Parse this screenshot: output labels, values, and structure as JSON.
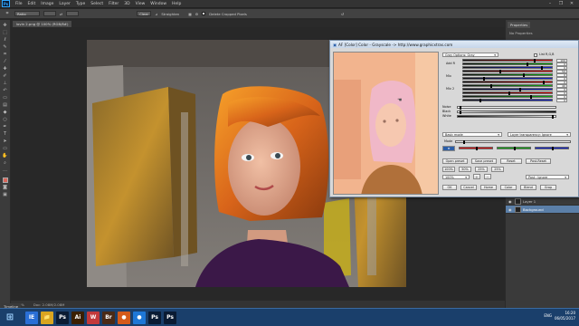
{
  "app": {
    "logo_text": "Ps"
  },
  "menu": {
    "items": [
      "File",
      "Edit",
      "Image",
      "Layer",
      "Type",
      "Select",
      "Filter",
      "3D",
      "View",
      "Window",
      "Help"
    ]
  },
  "window_controls": {
    "minimize": "–",
    "restore": "❐",
    "close": "✕"
  },
  "options_bar": {
    "ratio_value": "Ratio",
    "clear_label": "Clear",
    "straighten_label": "Straighten",
    "delete_cropped_label": "Delete Cropped Pixels"
  },
  "document": {
    "tab_label": "lovin 2.png @ 100% (RGB/8#)"
  },
  "status": {
    "zoom": "100%",
    "doc_info": "Doc: 2.08M/2.08M"
  },
  "panels": {
    "properties_tab": "Properties",
    "properties_text": "No Properties",
    "layers": [
      {
        "name": "Layer 1",
        "active": false
      },
      {
        "name": "Background",
        "active": true
      }
    ],
    "timeline_tab": "Timeline"
  },
  "dialog": {
    "title": "AF [Color] Color - Grayscale  -> http://www.graphicxtras.com",
    "preset": "Gray Options: Gray",
    "list_rgb_label": "List R,G,B",
    "channel_labels": [
      "Add R",
      "Mix",
      "Mix 2"
    ],
    "noise_label": "Noise",
    "black_label": "Black",
    "white_label": "White",
    "slider_values": [
      "100",
      "0",
      "0",
      "50",
      "0",
      "0",
      "0",
      "40",
      "0",
      "0",
      "0",
      "0"
    ],
    "blend_mode": "Basic mode",
    "layer_option": "Layer transparency: Ignore",
    "mode_label": "Mode",
    "buttons_row1": [
      "Open preset",
      "Save preset",
      "Reset",
      "Post-Reset"
    ],
    "zoom_buttons": [
      "100%",
      "50%",
      "25%",
      "25%"
    ],
    "zoom_select": "100%",
    "post_option": "Post : Ignore",
    "buttons_bottom": [
      "OK",
      "Cancel",
      "Home",
      "Color",
      "Blend",
      "Grap"
    ]
  },
  "taskbar": {
    "apps": [
      {
        "label": "IE",
        "color": "#2a6fd6"
      },
      {
        "label": "📁",
        "color": "#d9a520"
      },
      {
        "label": "Ps",
        "color": "#0a1b33"
      },
      {
        "label": "Ai",
        "color": "#3a1f00"
      },
      {
        "label": "W",
        "color": "#c2393b"
      },
      {
        "label": "Br",
        "color": "#4a2a16"
      },
      {
        "label": "●",
        "color": "#d45a1a"
      },
      {
        "label": "●",
        "color": "#1e77d6"
      },
      {
        "label": "Ps",
        "color": "#0a1b33"
      },
      {
        "label": "Ps",
        "color": "#0a1b33"
      }
    ],
    "language": "ENG",
    "time": "16:20",
    "date": "06/05/2017"
  }
}
